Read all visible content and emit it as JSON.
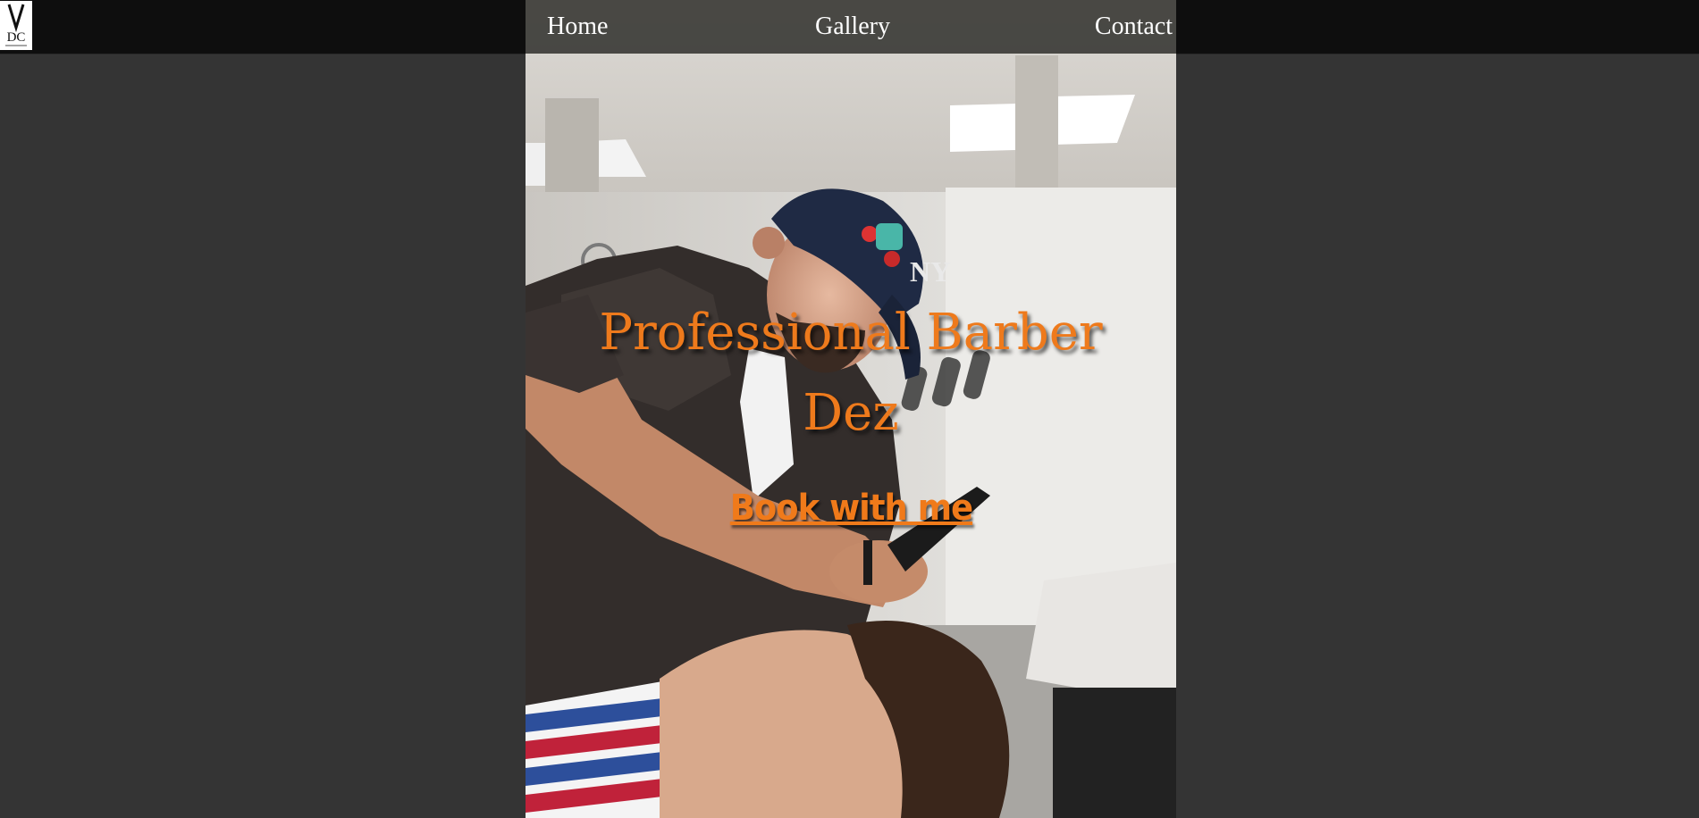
{
  "brand": {
    "logo_icon": "scissors-logo-icon",
    "logo_text": "DC"
  },
  "nav": {
    "items": [
      {
        "label": "Home"
      },
      {
        "label": "Gallery"
      },
      {
        "label": "Contact"
      }
    ]
  },
  "hero": {
    "image_icon": "barber-photo",
    "title_line1": "Professional Barber",
    "title_line2": "Dez",
    "cta_label": "Book with me"
  },
  "colors": {
    "page_background": "#343434",
    "topbar_background": "#0e0e0e",
    "accent_orange": "#ee7a1c",
    "nav_text": "#ffffff"
  }
}
